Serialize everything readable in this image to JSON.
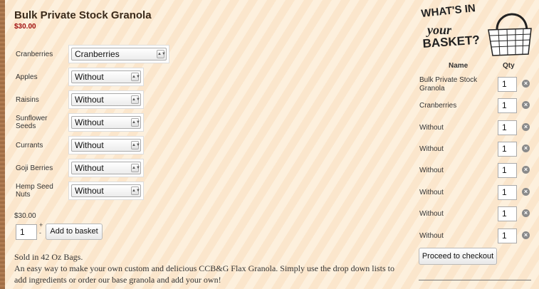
{
  "product": {
    "title": "Bulk Private Stock Granola",
    "price": "$30.00",
    "options": [
      {
        "label": "Cranberries",
        "value": "Cranberries"
      },
      {
        "label": "Apples",
        "value": "Without"
      },
      {
        "label": "Raisins",
        "value": "Without"
      },
      {
        "label": "Sunflower Seeds",
        "value": "Without"
      },
      {
        "label": "Currants",
        "value": "Without"
      },
      {
        "label": "Goji Berries",
        "value": "Without"
      },
      {
        "label": "Hemp Seed Nuts",
        "value": "Without"
      }
    ],
    "total_price": "$30.00",
    "quantity": "1",
    "stepper_plus": "+",
    "stepper_minus": "-",
    "add_to_basket_label": "Add to basket",
    "description": [
      "Sold in 42 Oz Bags.",
      "An easy way to make your own custom and delicious CCB&G Flax Granola. Simply use the drop down lists to add ingredients or order our base granola and add your own!"
    ]
  },
  "basket": {
    "logo_text": [
      "WHAT'S IN",
      "your",
      "BASKET?"
    ],
    "name_header": "Name",
    "qty_header": "Qty",
    "items": [
      {
        "name": "Bulk Private Stock Granola",
        "qty": "1"
      },
      {
        "name": "Cranberries",
        "qty": "1"
      },
      {
        "name": "Without",
        "qty": "1"
      },
      {
        "name": "Without",
        "qty": "1"
      },
      {
        "name": "Without",
        "qty": "1"
      },
      {
        "name": "Without",
        "qty": "1"
      },
      {
        "name": "Without",
        "qty": "1"
      },
      {
        "name": "Without",
        "qty": "1"
      }
    ],
    "checkout_label": "Proceed to checkout",
    "remove_icon": "close-circle-icon"
  },
  "colors": {
    "price_red": "#a01010",
    "stripe_light": "#fdf0dd",
    "stripe_dark": "#fbe6cc"
  }
}
